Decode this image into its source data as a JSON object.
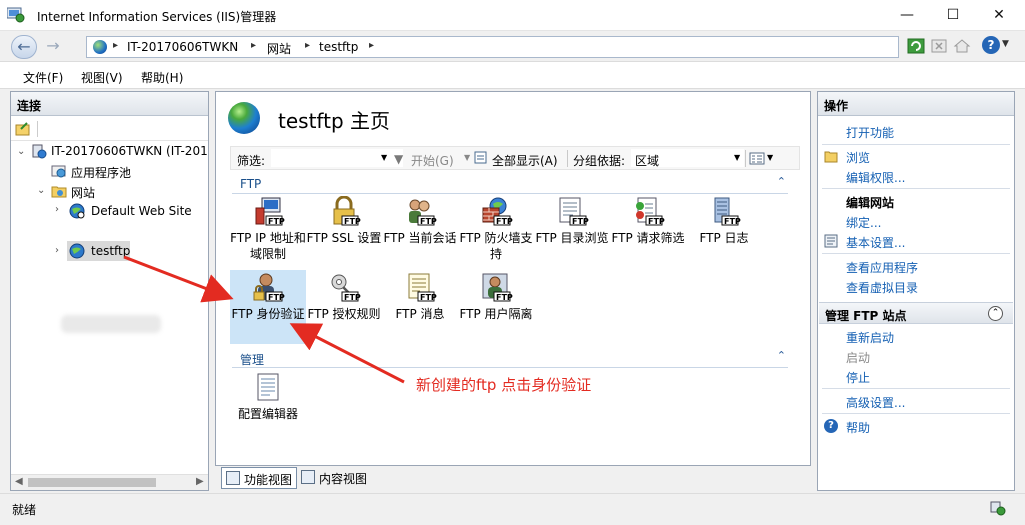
{
  "window": {
    "title": "Internet Information Services (IIS)管理器",
    "min_glyph": "—",
    "max_glyph": "☐",
    "close_glyph": "✕"
  },
  "address": {
    "crumbs": [
      "IT-20170606TWKN",
      "网站",
      "testftp"
    ],
    "sep": "▸"
  },
  "menu": {
    "items": [
      "文件(F)",
      "视图(V)",
      "帮助(H)"
    ]
  },
  "left_pane": {
    "header": "连接",
    "tree": [
      {
        "label": "IT-20170606TWKN (IT-201",
        "icon": "server-icon"
      },
      {
        "label": "应用程序池",
        "icon": "app-pool-icon"
      },
      {
        "label": "网站",
        "icon": "folder-icon"
      },
      {
        "label": "Default Web Site",
        "icon": "globe-icon"
      },
      {
        "label": "testftp",
        "icon": "globe-icon"
      }
    ]
  },
  "center": {
    "title": "testftp 主页",
    "filter_label": "筛选:",
    "start_label": "开始(G)",
    "show_all_label": "全部显示(A)",
    "group_by_label": "分组依据:",
    "group_by_value": "区域",
    "sections": {
      "ftp": "FTP",
      "manage": "管理"
    },
    "ftp_tag": "FTP",
    "features_row1": [
      "FTP IP 地址和域限制",
      "FTP SSL 设置",
      "FTP 当前会话",
      "FTP 防火墙支持",
      "FTP 目录浏览",
      "FTP 请求筛选",
      "FTP 日志"
    ],
    "features_row2": [
      "FTP 身份验证",
      "FTP 授权规则",
      "FTP 消息",
      "FTP 用户隔离"
    ],
    "manage_features": [
      "配置编辑器"
    ]
  },
  "view_tabs": {
    "features": "功能视图",
    "content": "内容视图"
  },
  "right_pane": {
    "header": "操作",
    "open_feature": "打开功能",
    "browse": "浏览",
    "edit_permissions": "编辑权限...",
    "edit_site_heading": "编辑网站",
    "bindings": "绑定...",
    "basic_settings": "基本设置...",
    "view_applications": "查看应用程序",
    "view_virtual_dirs": "查看虚拟目录",
    "manage_ftp_site": "管理 FTP 站点",
    "restart": "重新启动",
    "start": "启动",
    "stop": "停止",
    "advanced_settings": "高级设置...",
    "help": "帮助"
  },
  "status": {
    "text": "就绪"
  },
  "annotation": {
    "text": "新创建的ftp 点击身份验证",
    "color": "#e32b21"
  },
  "colors": {
    "selection": "#cce4f7",
    "link": "#1560b3",
    "section_header": "#1a4f8a"
  }
}
